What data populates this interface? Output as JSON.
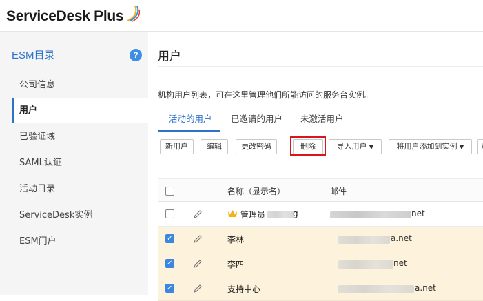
{
  "app": {
    "logo_text": "ServiceDesk Plus"
  },
  "sidebar": {
    "heading": "ESM目录",
    "help_glyph": "?",
    "items": [
      {
        "label": "公司信息"
      },
      {
        "label": "用户"
      },
      {
        "label": "已验证域"
      },
      {
        "label": "SAML认证"
      },
      {
        "label": "活动目录"
      },
      {
        "label": "ServiceDesk实例"
      },
      {
        "label": "ESM门户"
      }
    ],
    "active_item": "用户"
  },
  "main": {
    "title": "用户",
    "description": "机构用户列表，可在这里管理他们所能访问的服务台实例。",
    "tabs": [
      {
        "label": "活动的用户"
      },
      {
        "label": "已邀请的用户"
      },
      {
        "label": "未激活用户"
      }
    ],
    "active_tab": "活动的用户",
    "toolbar": {
      "new_user": "新用户",
      "edit": "编辑",
      "change_password": "更改密码",
      "delete": "删除",
      "import_users": "导入用户",
      "add_to_instance": "将用户添加到实例",
      "more": "从"
    },
    "table": {
      "columns": {
        "name": "名称（显示名）",
        "email": "邮件"
      },
      "rows": [
        {
          "name": "管理员",
          "name_tail": "g",
          "email_suffix": "net",
          "checked": false,
          "admin": true
        },
        {
          "name": "李林",
          "email_suffix": "a.net",
          "checked": true,
          "admin": false
        },
        {
          "name": "李四",
          "email_suffix": "net",
          "checked": true,
          "admin": false
        },
        {
          "name": "支持中心",
          "email_suffix": "a.net",
          "checked": true,
          "admin": false
        }
      ]
    }
  },
  "colors": {
    "accent": "#2e73c9",
    "highlight_box": "#d9161b",
    "selected_row": "#fdf2dc",
    "checkbox_checked": "#3b87e0"
  }
}
